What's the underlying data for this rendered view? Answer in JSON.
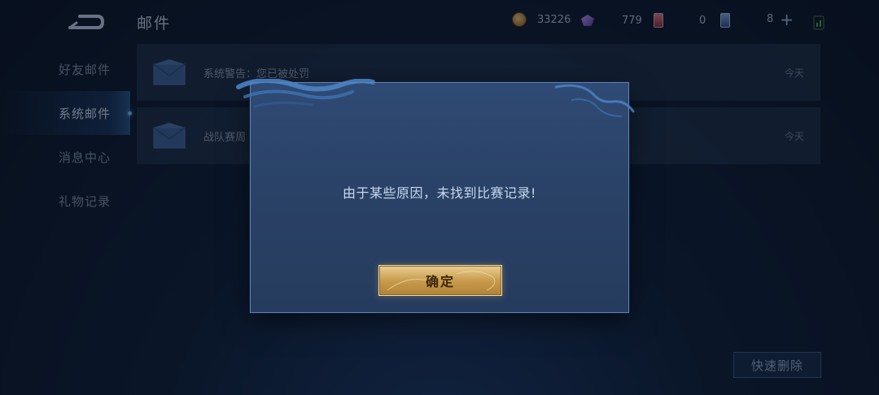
{
  "header": {
    "title": "邮件",
    "back_icon": "back-arrow-icon",
    "currencies": [
      {
        "icon": "gold-coin-icon",
        "value": "33226"
      },
      {
        "icon": "diamond-gem-icon",
        "value": "779"
      },
      {
        "icon": "red-ticket-icon",
        "value": "0"
      },
      {
        "icon": "blue-ticket-icon",
        "value": "8"
      }
    ],
    "add_icon": "plus-icon",
    "signal_icon": "signal-icon"
  },
  "sidebar": {
    "items": [
      {
        "label": "好友邮件",
        "active": false
      },
      {
        "label": "系统邮件",
        "active": true
      },
      {
        "label": "消息中心",
        "active": false
      },
      {
        "label": "礼物记录",
        "active": false
      }
    ]
  },
  "mail_list": [
    {
      "subject": "系统警告：您已被处罚",
      "date": "今天",
      "icon": "envelope-icon"
    },
    {
      "subject": "战队赛周",
      "date": "今天",
      "icon": "envelope-icon"
    }
  ],
  "quick_delete_label": "快速删除",
  "modal": {
    "message": "由于某些原因，未找到比赛记录!",
    "confirm_label": "确定"
  },
  "colors": {
    "background": "#0f1f3a",
    "modal_bg": "#2a4267",
    "modal_border": "#5f82b3",
    "confirm_gold": "#c99c4e",
    "active_dot": "#6fb2ff"
  }
}
